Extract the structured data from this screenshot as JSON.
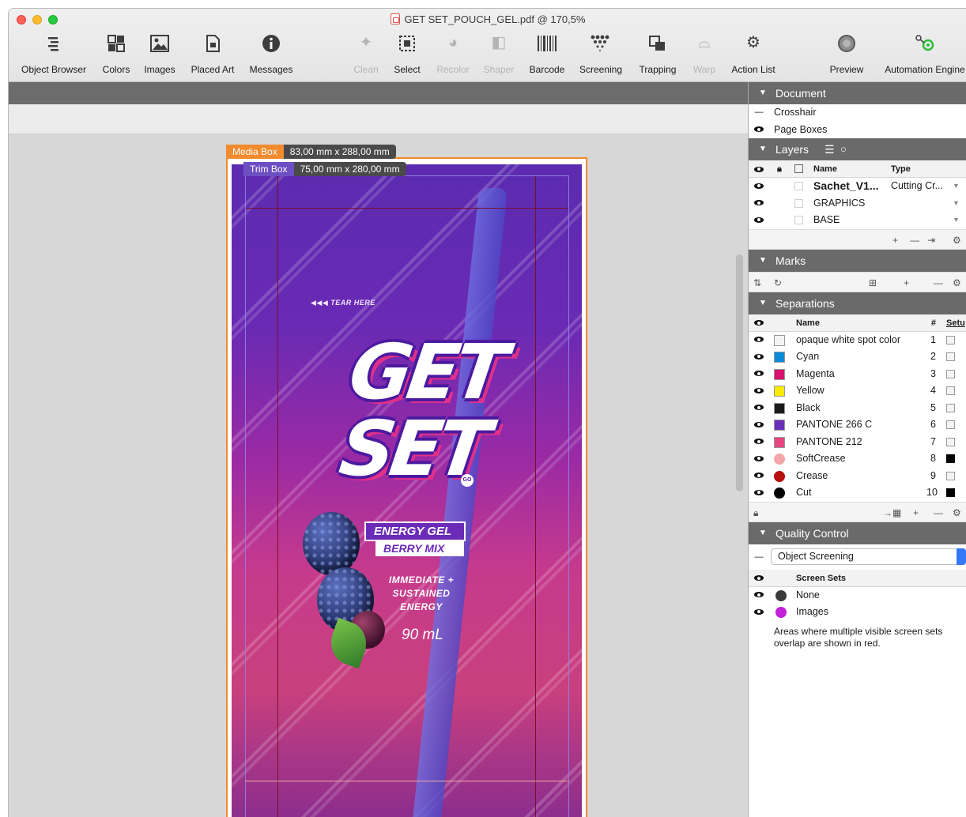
{
  "window": {
    "title": "GET SET_POUCH_GEL.pdf @ 170,5%"
  },
  "toolbar": {
    "items": [
      {
        "label": "Object Browser",
        "icon": "list-icon",
        "enabled": true
      },
      {
        "label": "Colors",
        "icon": "color-grid-icon",
        "enabled": true
      },
      {
        "label": "Images",
        "icon": "image-icon",
        "enabled": true
      },
      {
        "label": "Placed Art",
        "icon": "document-icon",
        "enabled": true
      },
      {
        "label": "Messages",
        "icon": "info-icon",
        "enabled": true
      },
      {
        "label": "Clean",
        "icon": "sparkle-icon",
        "enabled": false
      },
      {
        "label": "Select",
        "icon": "select-icon",
        "enabled": true
      },
      {
        "label": "Recolor",
        "icon": "recolor-icon",
        "enabled": false
      },
      {
        "label": "Shaper",
        "icon": "shaper-icon",
        "enabled": false
      },
      {
        "label": "Barcode",
        "icon": "barcode-icon",
        "enabled": true
      },
      {
        "label": "Screening",
        "icon": "screening-icon",
        "enabled": true
      },
      {
        "label": "Trapping",
        "icon": "trapping-icon",
        "enabled": true
      },
      {
        "label": "Warp",
        "icon": "warp-icon",
        "enabled": false
      },
      {
        "label": "Action List",
        "icon": "gears-icon",
        "enabled": true
      },
      {
        "label": "Preview",
        "icon": "preview-circle-icon",
        "enabled": true
      },
      {
        "label": "Automation Engine",
        "icon": "automation-engine-icon",
        "enabled": true
      }
    ]
  },
  "canvas": {
    "media_box_label": "Media Box",
    "media_box_size": "83,00 mm x 288,00 mm",
    "trim_box_label": "Trim Box",
    "trim_box_size": "75,00 mm x 280,00 mm",
    "artwork": {
      "tear_text": "◀◀◀ TEAR HERE",
      "logo_line1": "GET",
      "logo_line2": "SET",
      "logo_badge": "GO",
      "banner1": "ENERGY GEL",
      "banner2": "BERRY MIX",
      "desc1": "IMMEDIATE +",
      "desc2": "SUSTAINED",
      "desc3": "ENERGY",
      "volume": "90 mL"
    }
  },
  "panel": {
    "document": {
      "title": "Document",
      "rows": [
        {
          "icon": "minus-icon",
          "label": "Crosshair"
        },
        {
          "icon": "eye-icon",
          "label": "Page Boxes"
        }
      ]
    },
    "layers": {
      "title": "Layers",
      "col_name": "Name",
      "col_type": "Type",
      "rows": [
        {
          "name": "Sachet_V1...",
          "type": "Cutting Cr...",
          "bold": true
        },
        {
          "name": "GRAPHICS",
          "type": "",
          "bold": false
        },
        {
          "name": "BASE",
          "type": "",
          "bold": false
        }
      ]
    },
    "marks": {
      "title": "Marks"
    },
    "separations": {
      "title": "Separations",
      "col_name": "Name",
      "col_num": "#",
      "col_setup": "Setu",
      "rows": [
        {
          "name": "opaque white spot color",
          "num": "1",
          "color": "#f4f4f4",
          "round": false,
          "checked": false
        },
        {
          "name": "Cyan",
          "num": "2",
          "color": "#0a8ad8",
          "round": false,
          "checked": false
        },
        {
          "name": "Magenta",
          "num": "3",
          "color": "#d8126e",
          "round": false,
          "checked": false
        },
        {
          "name": "Yellow",
          "num": "4",
          "color": "#f7ea00",
          "round": false,
          "checked": false
        },
        {
          "name": "Black",
          "num": "5",
          "color": "#1a1a1a",
          "round": false,
          "checked": false
        },
        {
          "name": "PANTONE 266 C",
          "num": "6",
          "color": "#6a2fb9",
          "round": false,
          "checked": false
        },
        {
          "name": "PANTONE 212",
          "num": "7",
          "color": "#e7457f",
          "round": false,
          "checked": false
        },
        {
          "name": "SoftCrease",
          "num": "8",
          "color": "#f3a5a8",
          "round": true,
          "checked": true
        },
        {
          "name": "Crease",
          "num": "9",
          "color": "#b80f0f",
          "round": true,
          "checked": false
        },
        {
          "name": "Cut",
          "num": "10",
          "color": "#000000",
          "round": true,
          "checked": true
        }
      ]
    },
    "quality_control": {
      "title": "Quality Control",
      "selected": "Object Screening",
      "col_screen_sets": "Screen Sets",
      "rows": [
        {
          "name": "None",
          "color": "#3a3a3a"
        },
        {
          "name": "Images",
          "color": "#c21fd8"
        }
      ],
      "note": "Areas where multiple visible screen sets overlap are shown in red."
    }
  }
}
